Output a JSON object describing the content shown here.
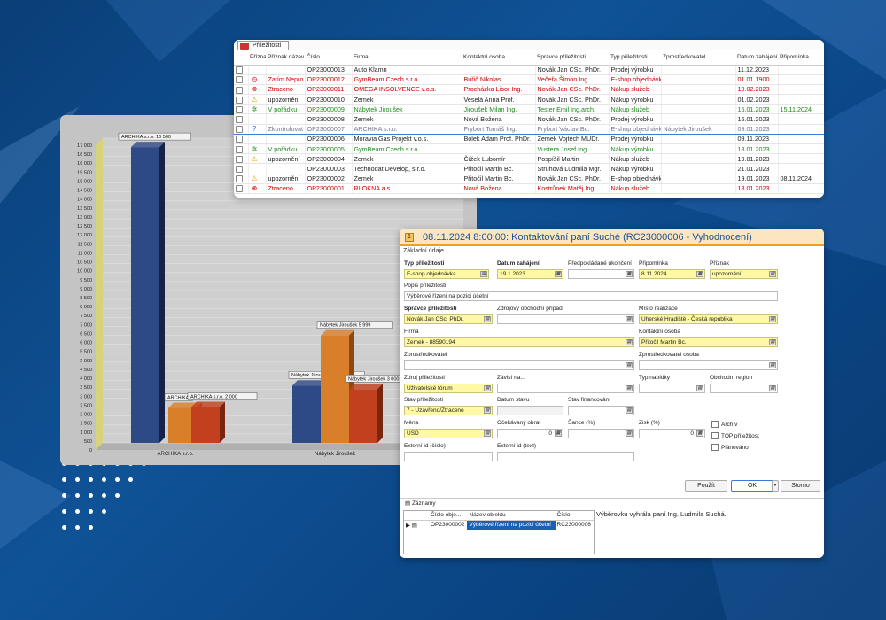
{
  "grid_window": {
    "tab_label": "Příležitosti",
    "columns": [
      "Příznak",
      "Příznak název",
      "Číslo",
      "Firma",
      "Kontaktní osoba",
      "Správce příležitosti",
      "Typ příležitosti",
      "Zprostředkovatel",
      "Datum zahájení",
      "Připomínka"
    ],
    "rows": [
      {
        "icon": "",
        "flag": "",
        "num": "OP23000013",
        "firm": "Auto Klamn",
        "contact": "",
        "manager": "Novák Jan CSc. PhDr.",
        "type": "Prodej výrobku",
        "agent": "",
        "date": "11.12.2023",
        "remind": "",
        "style": "normal"
      },
      {
        "icon": "◷",
        "flag": "Zatím Nepro",
        "num": "OP23000012",
        "firm": "GymBeam Czech s.r.o.",
        "contact": "Buřič Nikolas",
        "manager": "Večeřa Šimon Ing.",
        "type": "E-shop objednávk",
        "agent": "",
        "date": "01.01.1900",
        "remind": "",
        "style": "red"
      },
      {
        "icon": "⊗",
        "flag": "Ztraceno",
        "num": "OP23000011",
        "firm": "OMEGA INSOLVENCE v.o.s.",
        "contact": "Procházka Libor Ing.",
        "manager": "Novák Jan CSc. PhDr.",
        "type": "Nákup služeb",
        "agent": "",
        "date": "19.02.2023",
        "remind": "",
        "style": "red"
      },
      {
        "icon": "⚠",
        "flag": "upozornění",
        "num": "OP23000010",
        "firm": "Zemek",
        "contact": "Veselá Anna Prof.",
        "manager": "Novák Jan CSc. PhDr.",
        "type": "Nákup výrobku",
        "agent": "",
        "date": "01.02.2023",
        "remind": "",
        "style": "normal"
      },
      {
        "icon": "✲",
        "flag": "V pořádku",
        "num": "OP23000009",
        "firm": "Nábytek Jiroušek",
        "contact": "Jiroušek Milan Ing.",
        "manager": "Tester Emil Ing.arch.",
        "type": "Nákup služeb",
        "agent": "",
        "date": "16.01.2023",
        "remind": "15.11.2024",
        "style": "green"
      },
      {
        "icon": "",
        "flag": "",
        "num": "OP23000008",
        "firm": "Zemek",
        "contact": "Nová Božena",
        "manager": "Novák Jan CSc. PhDr.",
        "type": "Prodej výrobku",
        "agent": "",
        "date": "16.01.2023",
        "remind": "",
        "style": "normal"
      },
      {
        "icon": "?",
        "flag": "Zkontrolovat",
        "num": "OP23000007",
        "firm": "ARCHIKA s.r.o.",
        "contact": "Frybort Tomáš Ing.",
        "manager": "Frybort Václav Bc.",
        "type": "E-shop objednávk",
        "agent": "Nábytek Jiroušek",
        "date": "09.01.2023",
        "remind": "",
        "style": "grey",
        "selected": true
      },
      {
        "icon": "",
        "flag": "",
        "num": "OP23000006",
        "firm": "Moravia Gas Projekt v.o.s.",
        "contact": "Bolek Adam Prof. PhDr.",
        "manager": "Zemek Vojtěch MUDr.",
        "type": "Prodej výrobku",
        "agent": "",
        "date": "09.11.2023",
        "remind": "",
        "style": "normal"
      },
      {
        "icon": "✲",
        "flag": "V pořádku",
        "num": "OP23000005",
        "firm": "GymBeam Czech s.r.o.",
        "contact": "",
        "manager": "Vustera Josef Ing.",
        "type": "Nákup výrobku",
        "agent": "",
        "date": "18.01.2023",
        "remind": "",
        "style": "green"
      },
      {
        "icon": "⚠",
        "flag": "upozornění",
        "num": "OP23000004",
        "firm": "Zemek",
        "contact": "Čížek Lubomír",
        "manager": "Pospíšil Martin",
        "type": "Nákup služeb",
        "agent": "",
        "date": "19.01.2023",
        "remind": "",
        "style": "normal"
      },
      {
        "icon": "",
        "flag": "",
        "num": "OP23000003",
        "firm": "Technodat Develop, s.r.o.",
        "contact": "Přitočil Martin Bc.",
        "manager": "Struhová Ludmila Mgr.",
        "type": "Nákup výrobku",
        "agent": "",
        "date": "21.01.2023",
        "remind": "",
        "style": "normal"
      },
      {
        "icon": "⚠",
        "flag": "upozornění",
        "num": "OP23000002",
        "firm": "Zemek",
        "contact": "Přitočil Martin Bc.",
        "manager": "Novák Jan CSc. PhDr.",
        "type": "E-shop objednávk",
        "agent": "",
        "date": "19.01.2023",
        "remind": "08.11.2024",
        "style": "normal"
      },
      {
        "icon": "⊗",
        "flag": "Ztraceno",
        "num": "OP23000001",
        "firm": "RI OKNA a.s.",
        "contact": "Nová Božena",
        "manager": "Kostrůnek Matěj Ing.",
        "type": "Nákup služeb",
        "agent": "",
        "date": "18.01.2023",
        "remind": "",
        "style": "red"
      }
    ]
  },
  "chart_data": {
    "type": "bar",
    "categories": [
      "ARCHIKA s.r.o.",
      "Nábytek Jiroušek"
    ],
    "series": [
      {
        "values": [
          16500,
          3200
        ],
        "color": "#2e4a86"
      },
      {
        "values": [
          1950,
          5999
        ],
        "color": "#d97f2a"
      },
      {
        "values": [
          2000,
          3000
        ],
        "color": "#c2401e"
      }
    ],
    "data_labels": [
      [
        "ARCHIKA s.r.o. 16 500",
        "Nábytek Jiroušek 3 200"
      ],
      [
        "ARCHIKA",
        "Nábytek Jiroušek 5 999"
      ],
      [
        "ARCHIKA s.r.o. 2 000",
        "Nábytek Jiroušek 3 000"
      ]
    ],
    "ylim": [
      0,
      17000
    ],
    "yticks": [
      "0",
      "500",
      "1 000",
      "1 500",
      "2 000",
      "2 500",
      "3 000",
      "3 500",
      "4 000",
      "4 500",
      "5 000",
      "5 500",
      "6 000",
      "6 500",
      "7 000",
      "7 500",
      "8 000",
      "8 500",
      "9 000",
      "9 500",
      "10 000",
      "10 500",
      "11 000",
      "11 500",
      "12 000",
      "12 500",
      "13 000",
      "13 500",
      "14 000",
      "14 500",
      "15 000",
      "15 500",
      "16 000",
      "16 500",
      "17 000"
    ]
  },
  "dialog": {
    "title": "08.11.2024 8:00:00: Kontaktování paní Suché (RC23000006 - Vyhodnocení)",
    "section": "Základní údaje",
    "labels": {
      "typ": "Typ příležitosti",
      "datum": "Datum zahájení",
      "ukonceni": "Předpokládané ukončení",
      "pripominka": "Připomínka",
      "priznak": "Příznak",
      "popis": "Popis příležitosti",
      "spravce": "Správce příležitosti",
      "zdroj_obch": "Zdrojový obchodní případ",
      "misto": "Místo realizace",
      "firma": "Firma",
      "kontakt": "Kontaktní osoba",
      "zprost": "Zprostředkovatel",
      "zprost_osoba": "Zprostředkovatel osoba",
      "zdroj": "Zdroj příležitosti",
      "zavisi": "Závisí na...",
      "typ_nab": "Typ nabídky",
      "region": "Obchodní region",
      "stav": "Stav příležitosti",
      "datum_stavu": "Datum stavu",
      "stav_fin": "Stav financování",
      "mena": "Měna",
      "obrat": "Očekávaný obrat",
      "sance": "Šance (%)",
      "zisk": "Zisk (%)",
      "ext_cislo": "Externí id (číslo)",
      "ext_text": "Externí id (text)",
      "archiv": "Archív",
      "top": "TOP příležitost",
      "planovano": "Plánováno"
    },
    "values": {
      "typ": "E-shop objednávka",
      "datum": "19.1.2023",
      "pripominka": "8.11.2024",
      "priznak": "upozornění",
      "popis": "Výběrové řízení na pozici účetní",
      "spravce": "Novák Jan CSc. PhDr.",
      "misto": "Uherské Hradiště - Česká republika",
      "firma": "Zemek - 88590194",
      "kontakt": "Přitočil Martin Bc.",
      "zdroj": "Uživatelské fórum",
      "stav": "7 - Uzavřeno/Ztraceno",
      "mena": "USD",
      "obrat": "0",
      "zisk": "0"
    },
    "buttons": {
      "apply": "Použít",
      "ok": "OK",
      "cancel": "Storno"
    },
    "records_label": "Záznamy",
    "records_columns": [
      "Číslo obje...",
      "Název objektu",
      "Číslo"
    ],
    "records_row": {
      "num": "OP23000002",
      "name": "Výběrové řízení na pozici účetní",
      "code": "RC23000006"
    },
    "note": "Výběrovku vyhrála paní Ing. Ludmila Suchá."
  }
}
